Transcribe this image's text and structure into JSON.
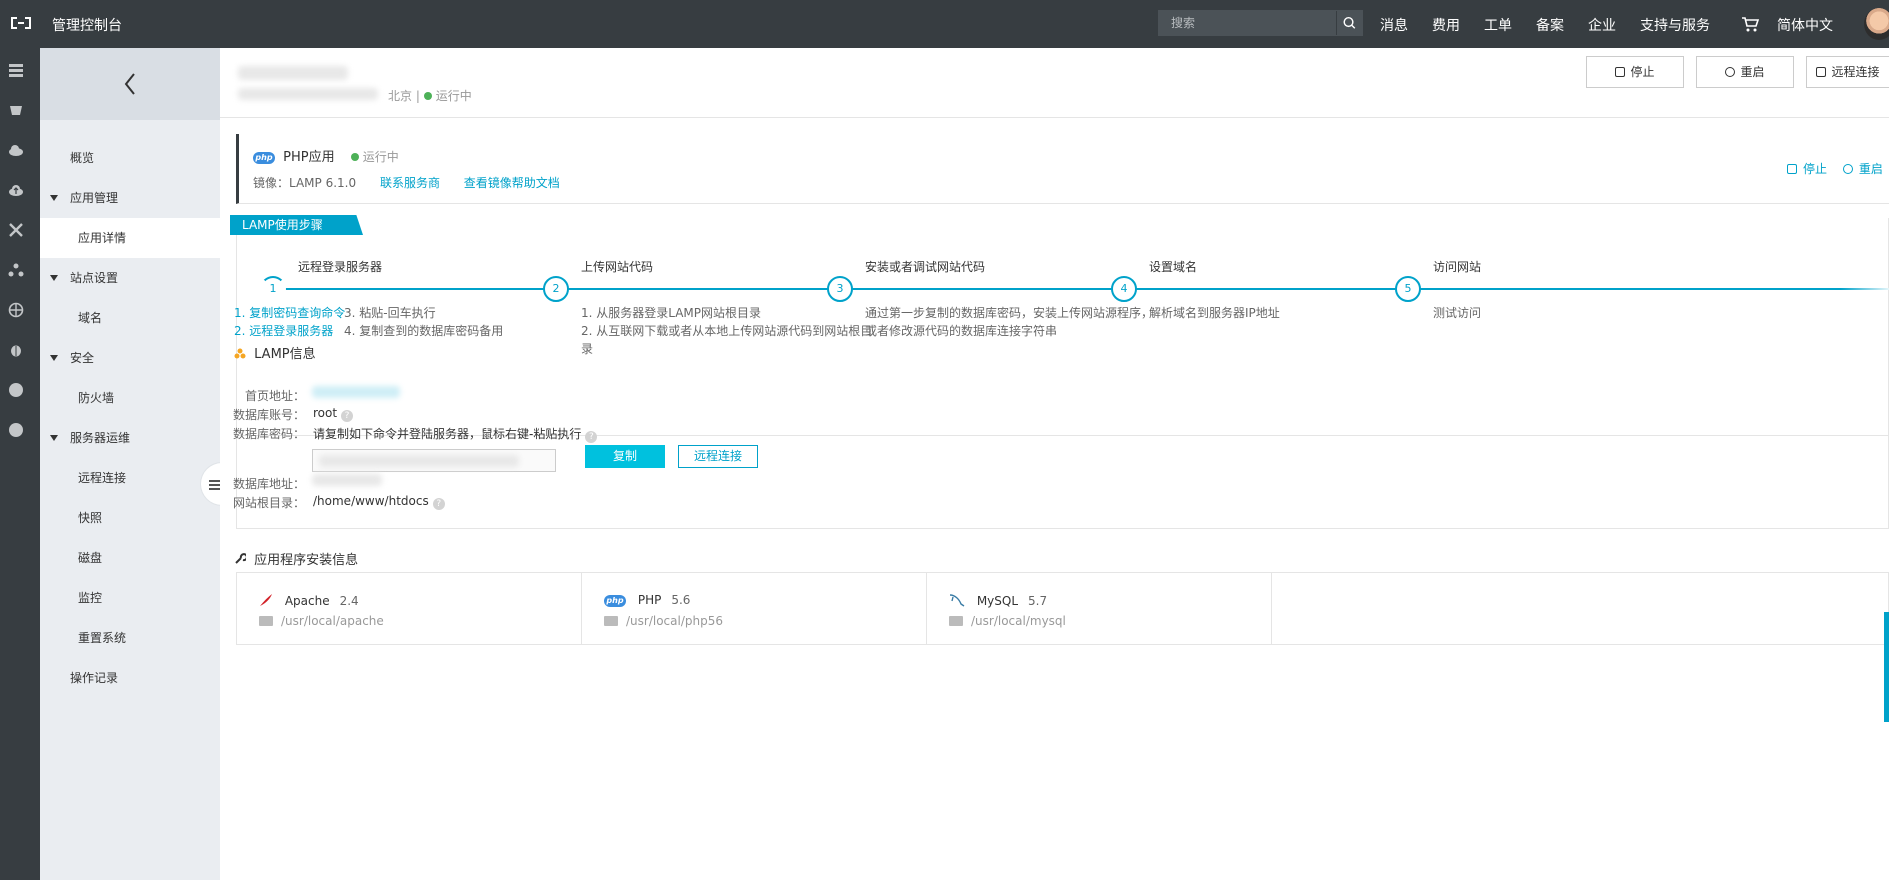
{
  "topbar": {
    "title": "管理控制台",
    "search_placeholder": "搜索",
    "nav": [
      "消息",
      "费用",
      "工单",
      "备案",
      "企业",
      "支持与服务",
      "简体中文"
    ]
  },
  "sidebar": {
    "items": [
      {
        "label": "概览"
      },
      {
        "label": "应用管理"
      },
      {
        "label": "应用详情"
      },
      {
        "label": "站点设置"
      },
      {
        "label": "域名"
      },
      {
        "label": "安全"
      },
      {
        "label": "防火墙"
      },
      {
        "label": "服务器运维"
      },
      {
        "label": "远程连接"
      },
      {
        "label": "快照"
      },
      {
        "label": "磁盘"
      },
      {
        "label": "监控"
      },
      {
        "label": "重置系统"
      },
      {
        "label": "操作记录"
      }
    ]
  },
  "header": {
    "region": "北京",
    "status": "运行中",
    "buttons": {
      "stop": "停止",
      "restart": "重启",
      "remote": "远程连接"
    }
  },
  "app_card": {
    "badge": "php",
    "title": "PHP应用",
    "status": "运行中",
    "image_label": "镜像：LAMP 6.1.0",
    "contact_link": "联系服务商",
    "help_link": "查看镜像帮助文档",
    "stop": "停止",
    "restart": "重启"
  },
  "steps": {
    "tag": "LAMP使用步骤",
    "items": [
      {
        "num": "1",
        "title": "远程登录服务器",
        "col1": [
          "1. 复制密码查询命令",
          "2. 远程登录服务器"
        ],
        "col2": [
          "3. 粘贴-回车执行",
          "4. 复制查到的数据库密码备用"
        ]
      },
      {
        "num": "2",
        "title": "上传网站代码",
        "desc": [
          "1. 从服务器登录LAMP网站根目录",
          "2. 从互联网下载或者从本地上传网站源代码到网站根目",
          "录"
        ]
      },
      {
        "num": "3",
        "title": "安装或者调试网站代码",
        "desc": [
          "通过第一步复制的数据库密码，安装上传网站源程序，",
          "或者修改源代码的数据库连接字符串"
        ]
      },
      {
        "num": "4",
        "title": "设置域名",
        "link": "解析域名到服务器IP地址"
      },
      {
        "num": "5",
        "title": "访问网站",
        "link": "测试访问"
      }
    ]
  },
  "lamp_info": {
    "title": "LAMP信息",
    "homepage_label": "首页地址：",
    "db_account_label": "数据库账号：",
    "db_account_value": "root",
    "db_password_label": "数据库密码：",
    "db_password_value": "请复制如下命令并登陆服务器，鼠标右键-粘贴执行",
    "copy_button": "复制",
    "remote_button": "远程连接",
    "db_address_label": "数据库地址：",
    "web_root_label": "网站根目录：",
    "web_root_value": "/home/www/htdocs"
  },
  "apps_info": {
    "title": "应用程序安装信息",
    "apps": [
      {
        "icon": "apache-feather-icon",
        "name": "Apache",
        "version": "2.4",
        "path": "/usr/local/apache"
      },
      {
        "icon": "php-icon",
        "name": "PHP",
        "version": "5.6",
        "path": "/usr/local/php56"
      },
      {
        "icon": "mysql-dolphin-icon",
        "name": "MySQL",
        "version": "5.7",
        "path": "/usr/local/mysql"
      }
    ]
  },
  "colors": {
    "accent": "#00a2ca",
    "primary_button": "#00c1de",
    "topbar": "#373d41",
    "running": "#4db158"
  }
}
